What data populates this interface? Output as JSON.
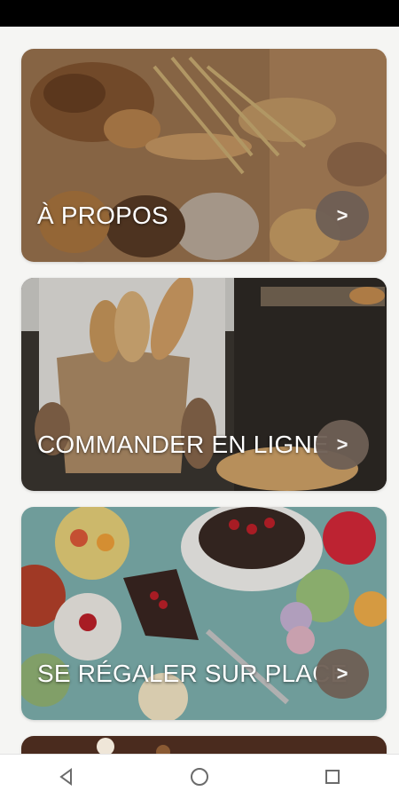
{
  "cards": [
    {
      "title": "À PROPOS",
      "action": ">"
    },
    {
      "title": "COMMANDER EN LIGNE",
      "action": ">"
    },
    {
      "title": "SE RÉGALER SUR PLACE",
      "action": ">"
    }
  ],
  "nav": {
    "back_icon": "back-triangle-icon",
    "home_icon": "home-circle-icon",
    "recents_icon": "recents-square-icon"
  },
  "colors": {
    "arrow_button": "#6e5f55",
    "status_bar": "#000000",
    "nav_bar": "#ffffff"
  }
}
